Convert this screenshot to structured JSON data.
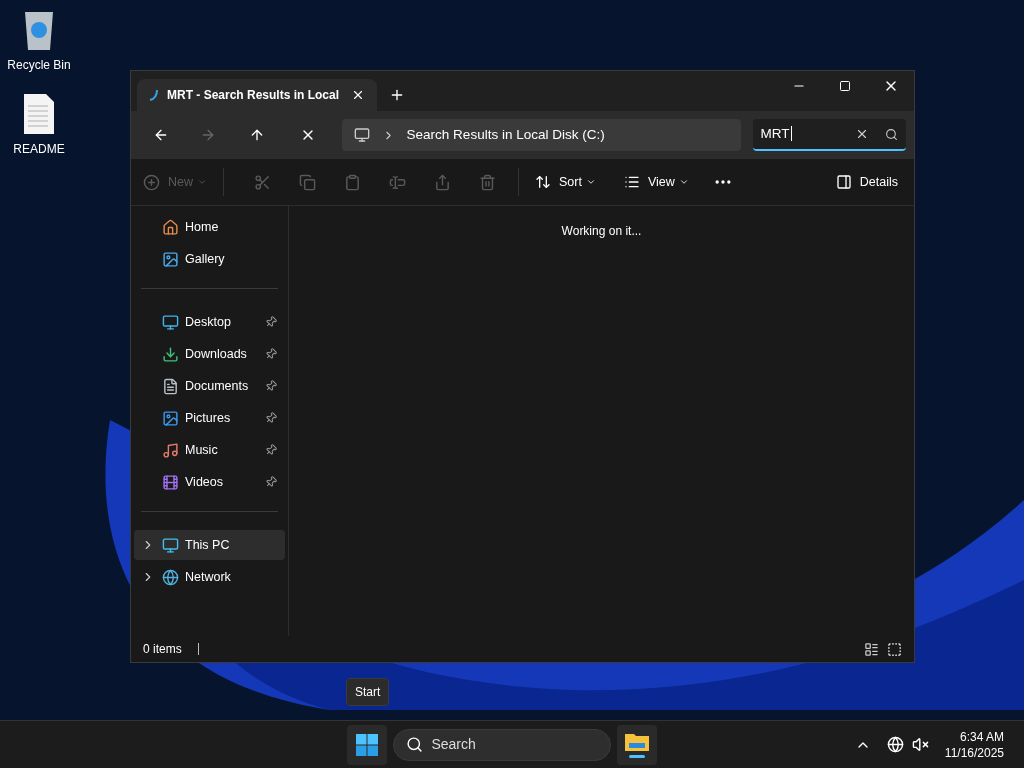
{
  "desktop_icons": [
    {
      "label": "Recycle Bin",
      "kind": "recycle"
    },
    {
      "label": "README",
      "kind": "document"
    }
  ],
  "window": {
    "tab": {
      "title": "MRT - Search Results in Local",
      "selected": true
    },
    "address": {
      "segment": "Search Results in Local Disk (C:)"
    },
    "search": {
      "value": "MRT"
    },
    "toolbar": {
      "new": {
        "label": "New",
        "disabled": true
      },
      "sort": "Sort",
      "view": "View",
      "details": "Details"
    },
    "sidebar": [
      [
        {
          "label": "Home",
          "kind": "home",
          "pinned": false,
          "selected": false
        },
        {
          "label": "Gallery",
          "kind": "gallery",
          "pinned": false,
          "selected": false
        }
      ],
      [
        {
          "label": "Desktop",
          "kind": "desktop",
          "pinned": true,
          "selected": false
        },
        {
          "label": "Downloads",
          "kind": "downloads",
          "pinned": true,
          "selected": false
        },
        {
          "label": "Documents",
          "kind": "documents",
          "pinned": true,
          "selected": false
        },
        {
          "label": "Pictures",
          "kind": "pictures",
          "pinned": true,
          "selected": false
        },
        {
          "label": "Music",
          "kind": "music",
          "pinned": true,
          "selected": false
        },
        {
          "label": "Videos",
          "kind": "videos",
          "pinned": true,
          "selected": false
        }
      ],
      [
        {
          "label": "This PC",
          "kind": "pc",
          "expandable": true,
          "pinned": false,
          "selected": true
        },
        {
          "label": "Network",
          "kind": "network",
          "expandable": true,
          "pinned": false,
          "selected": false
        }
      ]
    ],
    "content_message": "Working on it...",
    "status_bar": {
      "count": "0 items"
    }
  },
  "tooltip": "Start",
  "taskbar": {
    "search_placeholder": "Search",
    "time": "6:34 AM",
    "date": "11/16/2025"
  }
}
